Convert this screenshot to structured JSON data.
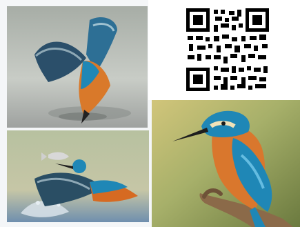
{
  "collage": {
    "panels": [
      {
        "subject": "kingfisher-diving"
      },
      {
        "subject": "kingfisher-catching-fish"
      },
      {
        "subject": "kingfisher-perched"
      }
    ]
  },
  "qr_code": {
    "description_icon": "qr-code-icon"
  },
  "colors": {
    "kingfisher_blue": "#1f87b6",
    "kingfisher_orange": "#d66a22",
    "water": "#8fa7b8",
    "perch_branch": "#8b6a49"
  }
}
